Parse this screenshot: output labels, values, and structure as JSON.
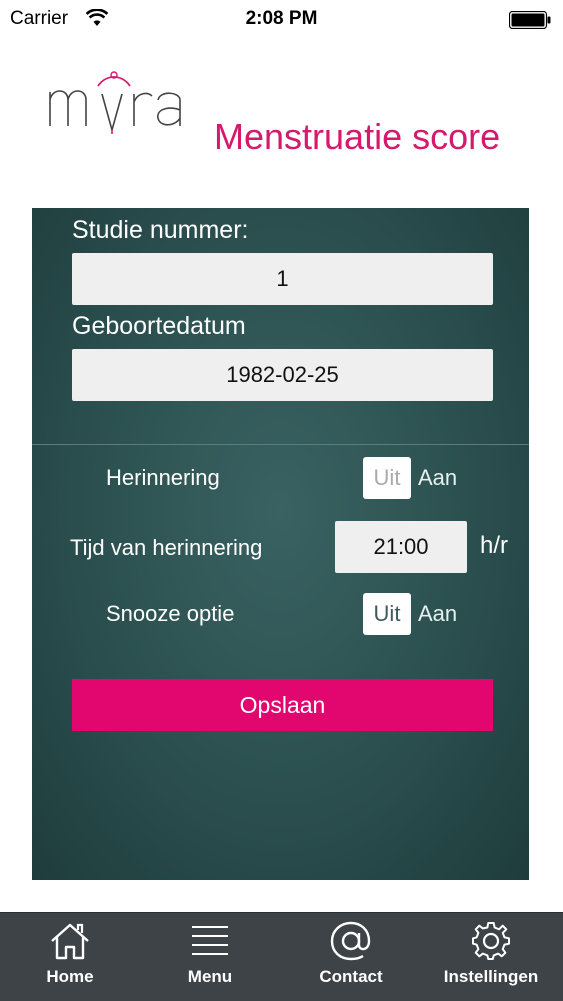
{
  "status_bar": {
    "carrier": "Carrier",
    "time": "2:08 PM"
  },
  "header": {
    "logo_text": "mra",
    "title": "Menstruatie score"
  },
  "form": {
    "study_number_label": "Studie nummer:",
    "study_number_value": "1",
    "birthdate_label": "Geboortedatum",
    "birthdate_value": "1982-02-25",
    "reminder": {
      "label": "Herinnering",
      "off_label": "Uit",
      "on_label": "Aan",
      "selected": "off"
    },
    "reminder_time": {
      "label": "Tijd van herinnering",
      "value": "21:00",
      "unit": "h/r"
    },
    "snooze": {
      "label": "Snooze optie",
      "off_label": "Uit",
      "on_label": "Aan",
      "selected": "off"
    },
    "save_label": "Opslaan"
  },
  "tab_bar": {
    "items": [
      {
        "label": "Home",
        "icon": "home-icon"
      },
      {
        "label": "Menu",
        "icon": "menu-icon"
      },
      {
        "label": "Contact",
        "icon": "at-icon"
      },
      {
        "label": "Instellingen",
        "icon": "gear-icon"
      }
    ]
  },
  "colors": {
    "brand_pink": "#d5196c",
    "button_pink": "#e2076f",
    "panel_teal": "#2b4f4f",
    "tab_bar": "#3e4347"
  }
}
